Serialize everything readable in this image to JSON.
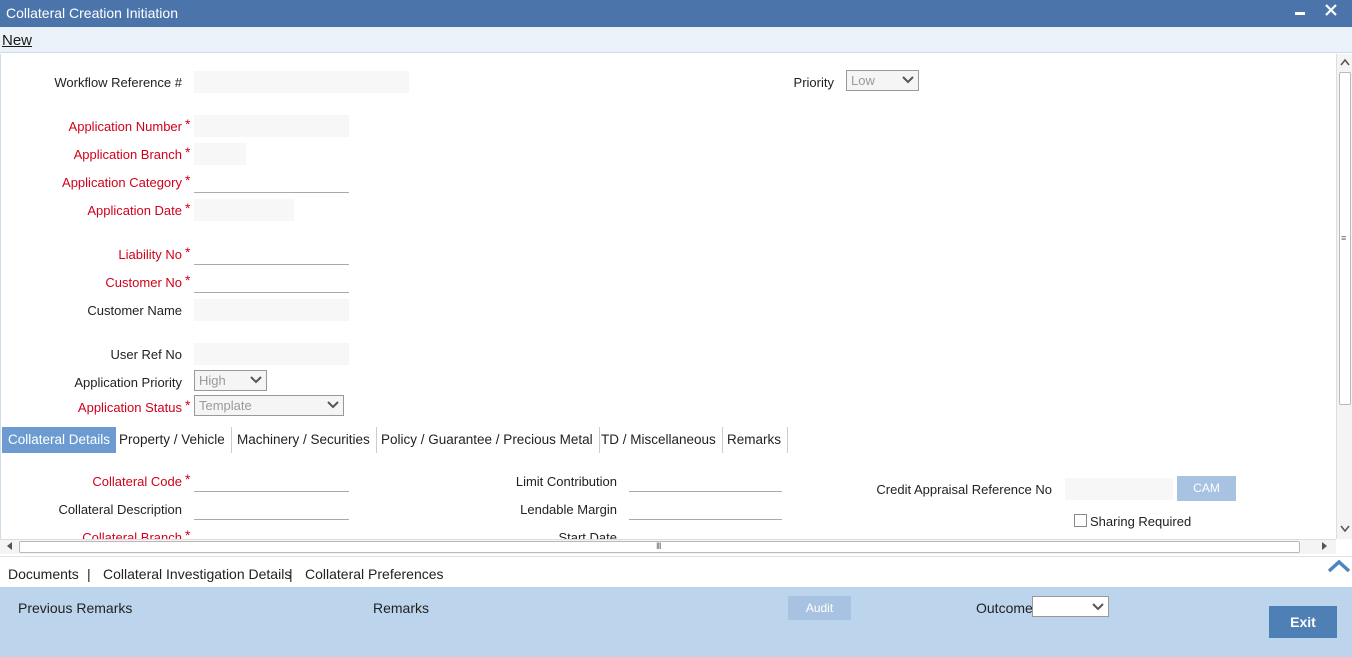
{
  "window": {
    "title": "Collateral Creation Initiation",
    "minimize_glyph": "▬",
    "close_glyph": "✕"
  },
  "menu": {
    "new_label": "New"
  },
  "form": {
    "workflow_ref": {
      "label": "Workflow Reference #",
      "value": ""
    },
    "priority": {
      "label": "Priority",
      "value": "Low"
    },
    "application_number": {
      "label": "Application Number",
      "value": ""
    },
    "application_branch": {
      "label": "Application Branch",
      "value": ""
    },
    "application_category": {
      "label": "Application Category",
      "value": ""
    },
    "application_date": {
      "label": "Application Date",
      "value": ""
    },
    "liability_no": {
      "label": "Liability No",
      "value": ""
    },
    "customer_no": {
      "label": "Customer No",
      "value": ""
    },
    "customer_name": {
      "label": "Customer Name",
      "value": ""
    },
    "user_ref_no": {
      "label": "User Ref No",
      "value": ""
    },
    "application_priority": {
      "label": "Application Priority",
      "value": "High"
    },
    "application_status": {
      "label": "Application Status",
      "value": "Template"
    },
    "required_marker": "*"
  },
  "tabs": [
    {
      "label": "Collateral Details",
      "active": true
    },
    {
      "label": "Property / Vehicle",
      "active": false
    },
    {
      "label": "Machinery / Securities",
      "active": false
    },
    {
      "label": "Policy / Guarantee / Precious Metal",
      "active": false
    },
    {
      "label": "TD / Miscellaneous",
      "active": false
    },
    {
      "label": "Remarks",
      "active": false
    }
  ],
  "collateral": {
    "collateral_code": {
      "label": "Collateral Code",
      "value": ""
    },
    "collateral_description": {
      "label": "Collateral Description",
      "value": ""
    },
    "collateral_branch": {
      "label": "Collateral Branch",
      "value": ""
    },
    "limit_contribution": {
      "label": "Limit Contribution",
      "value": ""
    },
    "lendable_margin": {
      "label": "Lendable Margin",
      "value": ""
    },
    "start_date": {
      "label": "Start Date",
      "value": ""
    },
    "credit_appraisal_ref": {
      "label": "Credit Appraisal Reference No",
      "value": ""
    },
    "cam_button": "CAM",
    "sharing_required": {
      "label": "Sharing Required",
      "checked": false
    }
  },
  "scrollbars": {
    "v_grip": "≡",
    "h_grip": "III"
  },
  "links": {
    "documents": "Documents",
    "investigation": "Collateral Investigation Details",
    "preferences": "Collateral Preferences",
    "separator": "|"
  },
  "footer": {
    "previous_remarks": "Previous Remarks",
    "remarks": "Remarks",
    "audit_button": "Audit",
    "outcome_label": "Outcome",
    "outcome_value": "",
    "exit_button": "Exit"
  },
  "colors": {
    "titlebar": "#4b74aa",
    "required": "#d0021b",
    "active_tab": "#6b9bd1",
    "footer": "#bcd4ec",
    "exit_button": "#4e7fb5"
  }
}
